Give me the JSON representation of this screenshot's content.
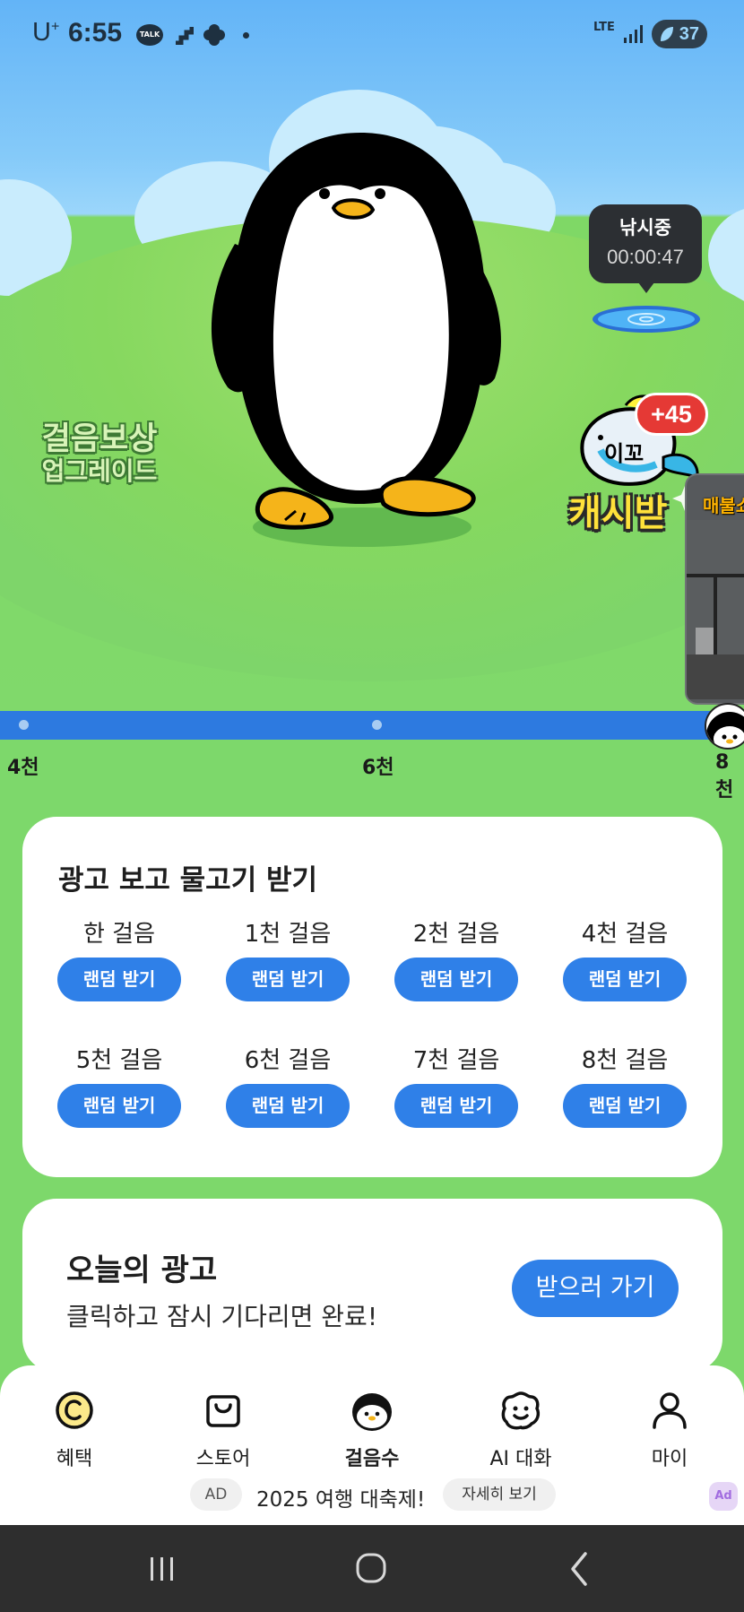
{
  "status_bar": {
    "carrier": "U",
    "carrier_sup": "+",
    "time": "6:55",
    "talk_icon": "TALK",
    "network": "LTE",
    "battery": "37"
  },
  "scene": {
    "fishing_title": "낚시중",
    "fishing_timer": "00:00:47",
    "upgrade_line1": "걸음보상",
    "upgrade_line2": "업그레이드",
    "cash_bonus": "+45",
    "cash_label": "캐시받",
    "fish_text": "이꼬",
    "video_title": "매불쇼"
  },
  "progress": {
    "milestones": [
      "4천",
      "6천",
      "8천"
    ]
  },
  "ad_card": {
    "title": "광고 보고 물고기 받기",
    "items": [
      {
        "label": "한 걸음",
        "button": "랜덤 받기"
      },
      {
        "label": "1천 걸음",
        "button": "랜덤 받기"
      },
      {
        "label": "2천 걸음",
        "button": "랜덤 받기"
      },
      {
        "label": "4천 걸음",
        "button": "랜덤 받기"
      },
      {
        "label": "5천 걸음",
        "button": "랜덤 받기"
      },
      {
        "label": "6천 걸음",
        "button": "랜덤 받기"
      },
      {
        "label": "7천 걸음",
        "button": "랜덤 받기"
      },
      {
        "label": "8천 걸음",
        "button": "랜덤 받기"
      }
    ]
  },
  "today_ad": {
    "title": "오늘의 광고",
    "subtitle": "클릭하고 잠시 기다리면 완료!",
    "button": "받으러 가기"
  },
  "bottom_nav": {
    "items": [
      {
        "label": "혜택",
        "icon": "coin-icon"
      },
      {
        "label": "스토어",
        "icon": "shopping-bag-icon"
      },
      {
        "label": "걸음수",
        "icon": "penguin-icon",
        "active": true
      },
      {
        "label": "AI 대화",
        "icon": "chat-face-icon"
      },
      {
        "label": "마이",
        "icon": "person-icon"
      }
    ],
    "ad_tag": "AD",
    "ad_text": "2025 여행 대축제!",
    "ad_detail": "자세히 보기",
    "ad_corner": "Ad"
  },
  "colors": {
    "primary_blue": "#2f80e8",
    "grass": "#7dd86b",
    "sky": "#63b4f7"
  }
}
